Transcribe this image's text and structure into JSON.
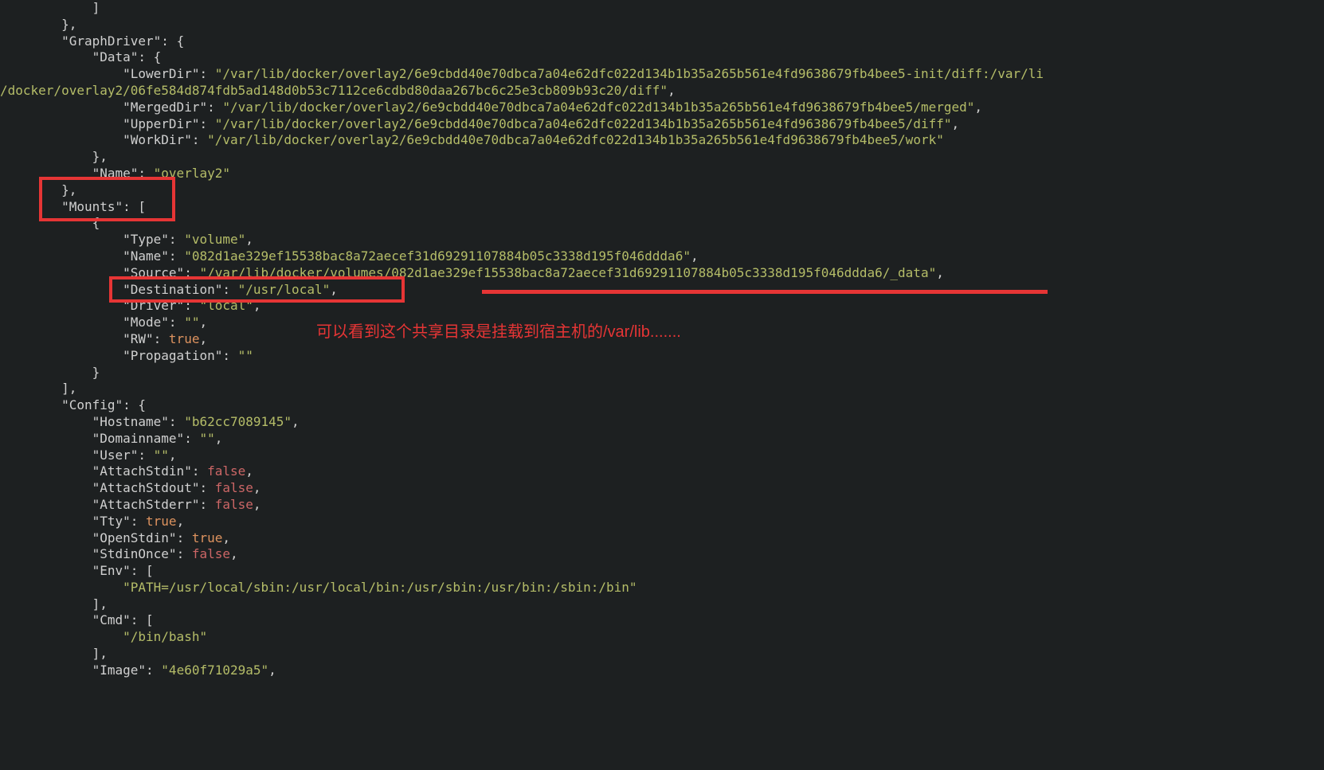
{
  "annotation": {
    "text": "可以看到这个共享目录是挂载到宿主机的/var/lib......."
  },
  "code": {
    "lines": [
      {
        "indent": 12,
        "tokens": [
          {
            "t": "]",
            "c": "p"
          }
        ]
      },
      {
        "indent": 8,
        "tokens": [
          {
            "t": "},",
            "c": "p"
          }
        ]
      },
      {
        "indent": 8,
        "tokens": [
          {
            "t": "\"GraphDriver\"",
            "c": "k"
          },
          {
            "t": ": {",
            "c": "p"
          }
        ]
      },
      {
        "indent": 12,
        "tokens": [
          {
            "t": "\"Data\"",
            "c": "k"
          },
          {
            "t": ": {",
            "c": "p"
          }
        ]
      },
      {
        "indent": 16,
        "tokens": [
          {
            "t": "\"LowerDir\"",
            "c": "k"
          },
          {
            "t": ": ",
            "c": "p"
          },
          {
            "t": "\"/var/lib/docker/overlay2/6e9cbdd40e70dbca7a04e62dfc022d134b1b35a265b561e4fd9638679fb4bee5-init/diff:/var/li",
            "c": "s"
          }
        ]
      },
      {
        "indent": 0,
        "tokens": [
          {
            "t": "/docker/overlay2/06fe584d874fdb5ad148d0b53c7112ce6cdbd80daa267bc6c25e3cb809b93c20/diff\"",
            "c": "s"
          },
          {
            "t": ",",
            "c": "p"
          }
        ]
      },
      {
        "indent": 16,
        "tokens": [
          {
            "t": "\"MergedDir\"",
            "c": "k"
          },
          {
            "t": ": ",
            "c": "p"
          },
          {
            "t": "\"/var/lib/docker/overlay2/6e9cbdd40e70dbca7a04e62dfc022d134b1b35a265b561e4fd9638679fb4bee5/merged\"",
            "c": "s"
          },
          {
            "t": ",",
            "c": "p"
          }
        ]
      },
      {
        "indent": 16,
        "tokens": [
          {
            "t": "\"UpperDir\"",
            "c": "k"
          },
          {
            "t": ": ",
            "c": "p"
          },
          {
            "t": "\"/var/lib/docker/overlay2/6e9cbdd40e70dbca7a04e62dfc022d134b1b35a265b561e4fd9638679fb4bee5/diff\"",
            "c": "s"
          },
          {
            "t": ",",
            "c": "p"
          }
        ]
      },
      {
        "indent": 16,
        "tokens": [
          {
            "t": "\"WorkDir\"",
            "c": "k"
          },
          {
            "t": ": ",
            "c": "p"
          },
          {
            "t": "\"/var/lib/docker/overlay2/6e9cbdd40e70dbca7a04e62dfc022d134b1b35a265b561e4fd9638679fb4bee5/work\"",
            "c": "s"
          }
        ]
      },
      {
        "indent": 12,
        "tokens": [
          {
            "t": "},",
            "c": "p"
          }
        ]
      },
      {
        "indent": 12,
        "tokens": [
          {
            "t": "\"Name\"",
            "c": "k"
          },
          {
            "t": ": ",
            "c": "p"
          },
          {
            "t": "\"overlay2\"",
            "c": "s"
          }
        ]
      },
      {
        "indent": 8,
        "tokens": [
          {
            "t": "},",
            "c": "p"
          }
        ]
      },
      {
        "indent": 8,
        "tokens": [
          {
            "t": "\"Mounts\"",
            "c": "k"
          },
          {
            "t": ": [",
            "c": "p"
          }
        ]
      },
      {
        "indent": 12,
        "tokens": [
          {
            "t": "{",
            "c": "p"
          }
        ]
      },
      {
        "indent": 16,
        "tokens": [
          {
            "t": "\"Type\"",
            "c": "k"
          },
          {
            "t": ": ",
            "c": "p"
          },
          {
            "t": "\"volume\"",
            "c": "s"
          },
          {
            "t": ",",
            "c": "p"
          }
        ]
      },
      {
        "indent": 16,
        "tokens": [
          {
            "t": "\"Name\"",
            "c": "k"
          },
          {
            "t": ": ",
            "c": "p"
          },
          {
            "t": "\"082d1ae329ef15538bac8a72aecef31d69291107884b05c3338d195f046ddda6\"",
            "c": "s"
          },
          {
            "t": ",",
            "c": "p"
          }
        ]
      },
      {
        "indent": 16,
        "tokens": [
          {
            "t": "\"Source\"",
            "c": "k"
          },
          {
            "t": ": ",
            "c": "p"
          },
          {
            "t": "\"/var/lib/docker/volumes/082d1ae329ef15538bac8a72aecef31d69291107884b05c3338d195f046ddda6/_data\"",
            "c": "s"
          },
          {
            "t": ",",
            "c": "p"
          }
        ]
      },
      {
        "indent": 16,
        "tokens": [
          {
            "t": "\"Destination\"",
            "c": "k"
          },
          {
            "t": ": ",
            "c": "p"
          },
          {
            "t": "\"/usr/local\"",
            "c": "s"
          },
          {
            "t": ",",
            "c": "p"
          }
        ]
      },
      {
        "indent": 16,
        "tokens": [
          {
            "t": "\"Driver\"",
            "c": "k"
          },
          {
            "t": ": ",
            "c": "p"
          },
          {
            "t": "\"local\"",
            "c": "s"
          },
          {
            "t": ",",
            "c": "p"
          }
        ]
      },
      {
        "indent": 16,
        "tokens": [
          {
            "t": "\"Mode\"",
            "c": "k"
          },
          {
            "t": ": ",
            "c": "p"
          },
          {
            "t": "\"\"",
            "c": "s"
          },
          {
            "t": ",",
            "c": "p"
          }
        ]
      },
      {
        "indent": 16,
        "tokens": [
          {
            "t": "\"RW\"",
            "c": "k"
          },
          {
            "t": ": ",
            "c": "p"
          },
          {
            "t": "true",
            "c": "bt"
          },
          {
            "t": ",",
            "c": "p"
          }
        ]
      },
      {
        "indent": 16,
        "tokens": [
          {
            "t": "\"Propagation\"",
            "c": "k"
          },
          {
            "t": ": ",
            "c": "p"
          },
          {
            "t": "\"\"",
            "c": "s"
          }
        ]
      },
      {
        "indent": 12,
        "tokens": [
          {
            "t": "}",
            "c": "p"
          }
        ]
      },
      {
        "indent": 8,
        "tokens": [
          {
            "t": "],",
            "c": "p"
          }
        ]
      },
      {
        "indent": 8,
        "tokens": [
          {
            "t": "\"Config\"",
            "c": "k"
          },
          {
            "t": ": {",
            "c": "p"
          }
        ]
      },
      {
        "indent": 12,
        "tokens": [
          {
            "t": "\"Hostname\"",
            "c": "k"
          },
          {
            "t": ": ",
            "c": "p"
          },
          {
            "t": "\"b62cc7089145\"",
            "c": "s"
          },
          {
            "t": ",",
            "c": "p"
          }
        ]
      },
      {
        "indent": 12,
        "tokens": [
          {
            "t": "\"Domainname\"",
            "c": "k"
          },
          {
            "t": ": ",
            "c": "p"
          },
          {
            "t": "\"\"",
            "c": "s"
          },
          {
            "t": ",",
            "c": "p"
          }
        ]
      },
      {
        "indent": 12,
        "tokens": [
          {
            "t": "\"User\"",
            "c": "k"
          },
          {
            "t": ": ",
            "c": "p"
          },
          {
            "t": "\"\"",
            "c": "s"
          },
          {
            "t": ",",
            "c": "p"
          }
        ]
      },
      {
        "indent": 12,
        "tokens": [
          {
            "t": "\"AttachStdin\"",
            "c": "k"
          },
          {
            "t": ": ",
            "c": "p"
          },
          {
            "t": "false",
            "c": "bf"
          },
          {
            "t": ",",
            "c": "p"
          }
        ]
      },
      {
        "indent": 12,
        "tokens": [
          {
            "t": "\"AttachStdout\"",
            "c": "k"
          },
          {
            "t": ": ",
            "c": "p"
          },
          {
            "t": "false",
            "c": "bf"
          },
          {
            "t": ",",
            "c": "p"
          }
        ]
      },
      {
        "indent": 12,
        "tokens": [
          {
            "t": "\"AttachStderr\"",
            "c": "k"
          },
          {
            "t": ": ",
            "c": "p"
          },
          {
            "t": "false",
            "c": "bf"
          },
          {
            "t": ",",
            "c": "p"
          }
        ]
      },
      {
        "indent": 12,
        "tokens": [
          {
            "t": "\"Tty\"",
            "c": "k"
          },
          {
            "t": ": ",
            "c": "p"
          },
          {
            "t": "true",
            "c": "bt"
          },
          {
            "t": ",",
            "c": "p"
          }
        ]
      },
      {
        "indent": 12,
        "tokens": [
          {
            "t": "\"OpenStdin\"",
            "c": "k"
          },
          {
            "t": ": ",
            "c": "p"
          },
          {
            "t": "true",
            "c": "bt"
          },
          {
            "t": ",",
            "c": "p"
          }
        ]
      },
      {
        "indent": 12,
        "tokens": [
          {
            "t": "\"StdinOnce\"",
            "c": "k"
          },
          {
            "t": ": ",
            "c": "p"
          },
          {
            "t": "false",
            "c": "bf"
          },
          {
            "t": ",",
            "c": "p"
          }
        ]
      },
      {
        "indent": 12,
        "tokens": [
          {
            "t": "\"Env\"",
            "c": "k"
          },
          {
            "t": ": [",
            "c": "p"
          }
        ]
      },
      {
        "indent": 16,
        "tokens": [
          {
            "t": "\"PATH=/usr/local/sbin:/usr/local/bin:/usr/sbin:/usr/bin:/sbin:/bin\"",
            "c": "s"
          }
        ]
      },
      {
        "indent": 12,
        "tokens": [
          {
            "t": "],",
            "c": "p"
          }
        ]
      },
      {
        "indent": 12,
        "tokens": [
          {
            "t": "\"Cmd\"",
            "c": "k"
          },
          {
            "t": ": [",
            "c": "p"
          }
        ]
      },
      {
        "indent": 16,
        "tokens": [
          {
            "t": "\"/bin/bash\"",
            "c": "s"
          }
        ]
      },
      {
        "indent": 12,
        "tokens": [
          {
            "t": "],",
            "c": "p"
          }
        ]
      },
      {
        "indent": 12,
        "tokens": [
          {
            "t": "\"Image\"",
            "c": "k"
          },
          {
            "t": ": ",
            "c": "p"
          },
          {
            "t": "\"4e60f71029a5\"",
            "c": "s"
          },
          {
            "t": ",",
            "c": "p"
          }
        ]
      }
    ]
  }
}
